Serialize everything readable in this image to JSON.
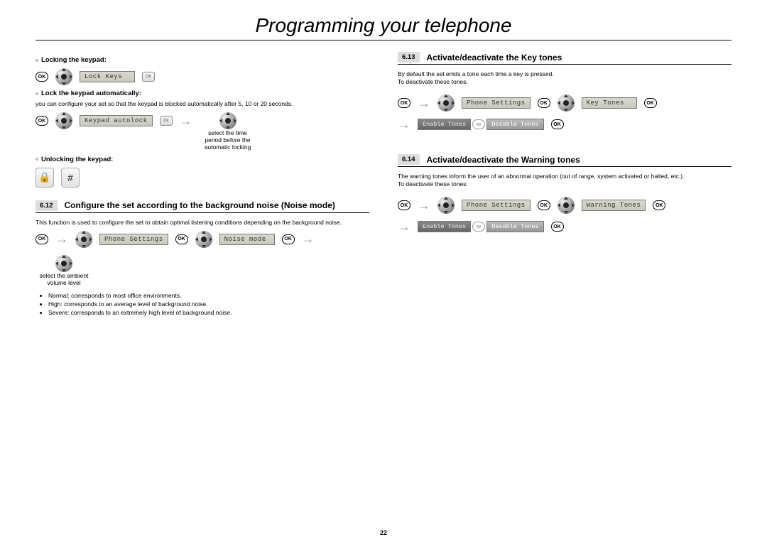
{
  "page": {
    "title": "Programming your telephone",
    "number": "22"
  },
  "left": {
    "sub_lock": "Locking the keypad:",
    "lcd_lock": "Lock Keys",
    "sub_auto": "Lock the keypad automatically:",
    "auto_desc": "you can configure your set so that the keypad is blocked automatically after 5, 10 or 20 seconds.",
    "lcd_auto": "Keypad autolock",
    "caption_auto": "select the time period before the automatic locking",
    "sub_unlock": "Unlocking the keypad:",
    "btn_hash": "#",
    "s612_num": "6.12",
    "s612_title": "Configure the set according to the background noise (Noise mode)",
    "s612_desc": "This function is used to configure the set to obtain optimal listening conditions depending on the background noise.",
    "lcd_phone": "Phone Settings",
    "lcd_noise": "Noise mode",
    "caption_noise": "select the ambient volume level",
    "bullets": [
      "Normal: corresponds to most office environments.",
      "High: corresponds to an average level of background noise.",
      "Severe: corresponds to an extremely high level of background noise."
    ]
  },
  "right": {
    "s613_num": "6.13",
    "s613_title": "Activate/deactivate the Key tones",
    "s613_desc1": "By default the set emits a tone each time a key is pressed.",
    "s613_desc2": "To deactivate these tones:",
    "lcd_phone": "Phone Settings",
    "lcd_keytones": "Key Tones",
    "toggle_enable": "Enable Tones",
    "toggle_disable": "Desable Tones",
    "s614_num": "6.14",
    "s614_title": "Activate/deactivate the Warning tones",
    "s614_desc1": "The warning tones inform the user of an abnormal operation (out of range, system activated or halted, etc.).",
    "s614_desc2": "To deactivate these tones:",
    "lcd_warning": "Warning Tones"
  },
  "labels": {
    "ok": "OK",
    "okkey": "Ok"
  }
}
